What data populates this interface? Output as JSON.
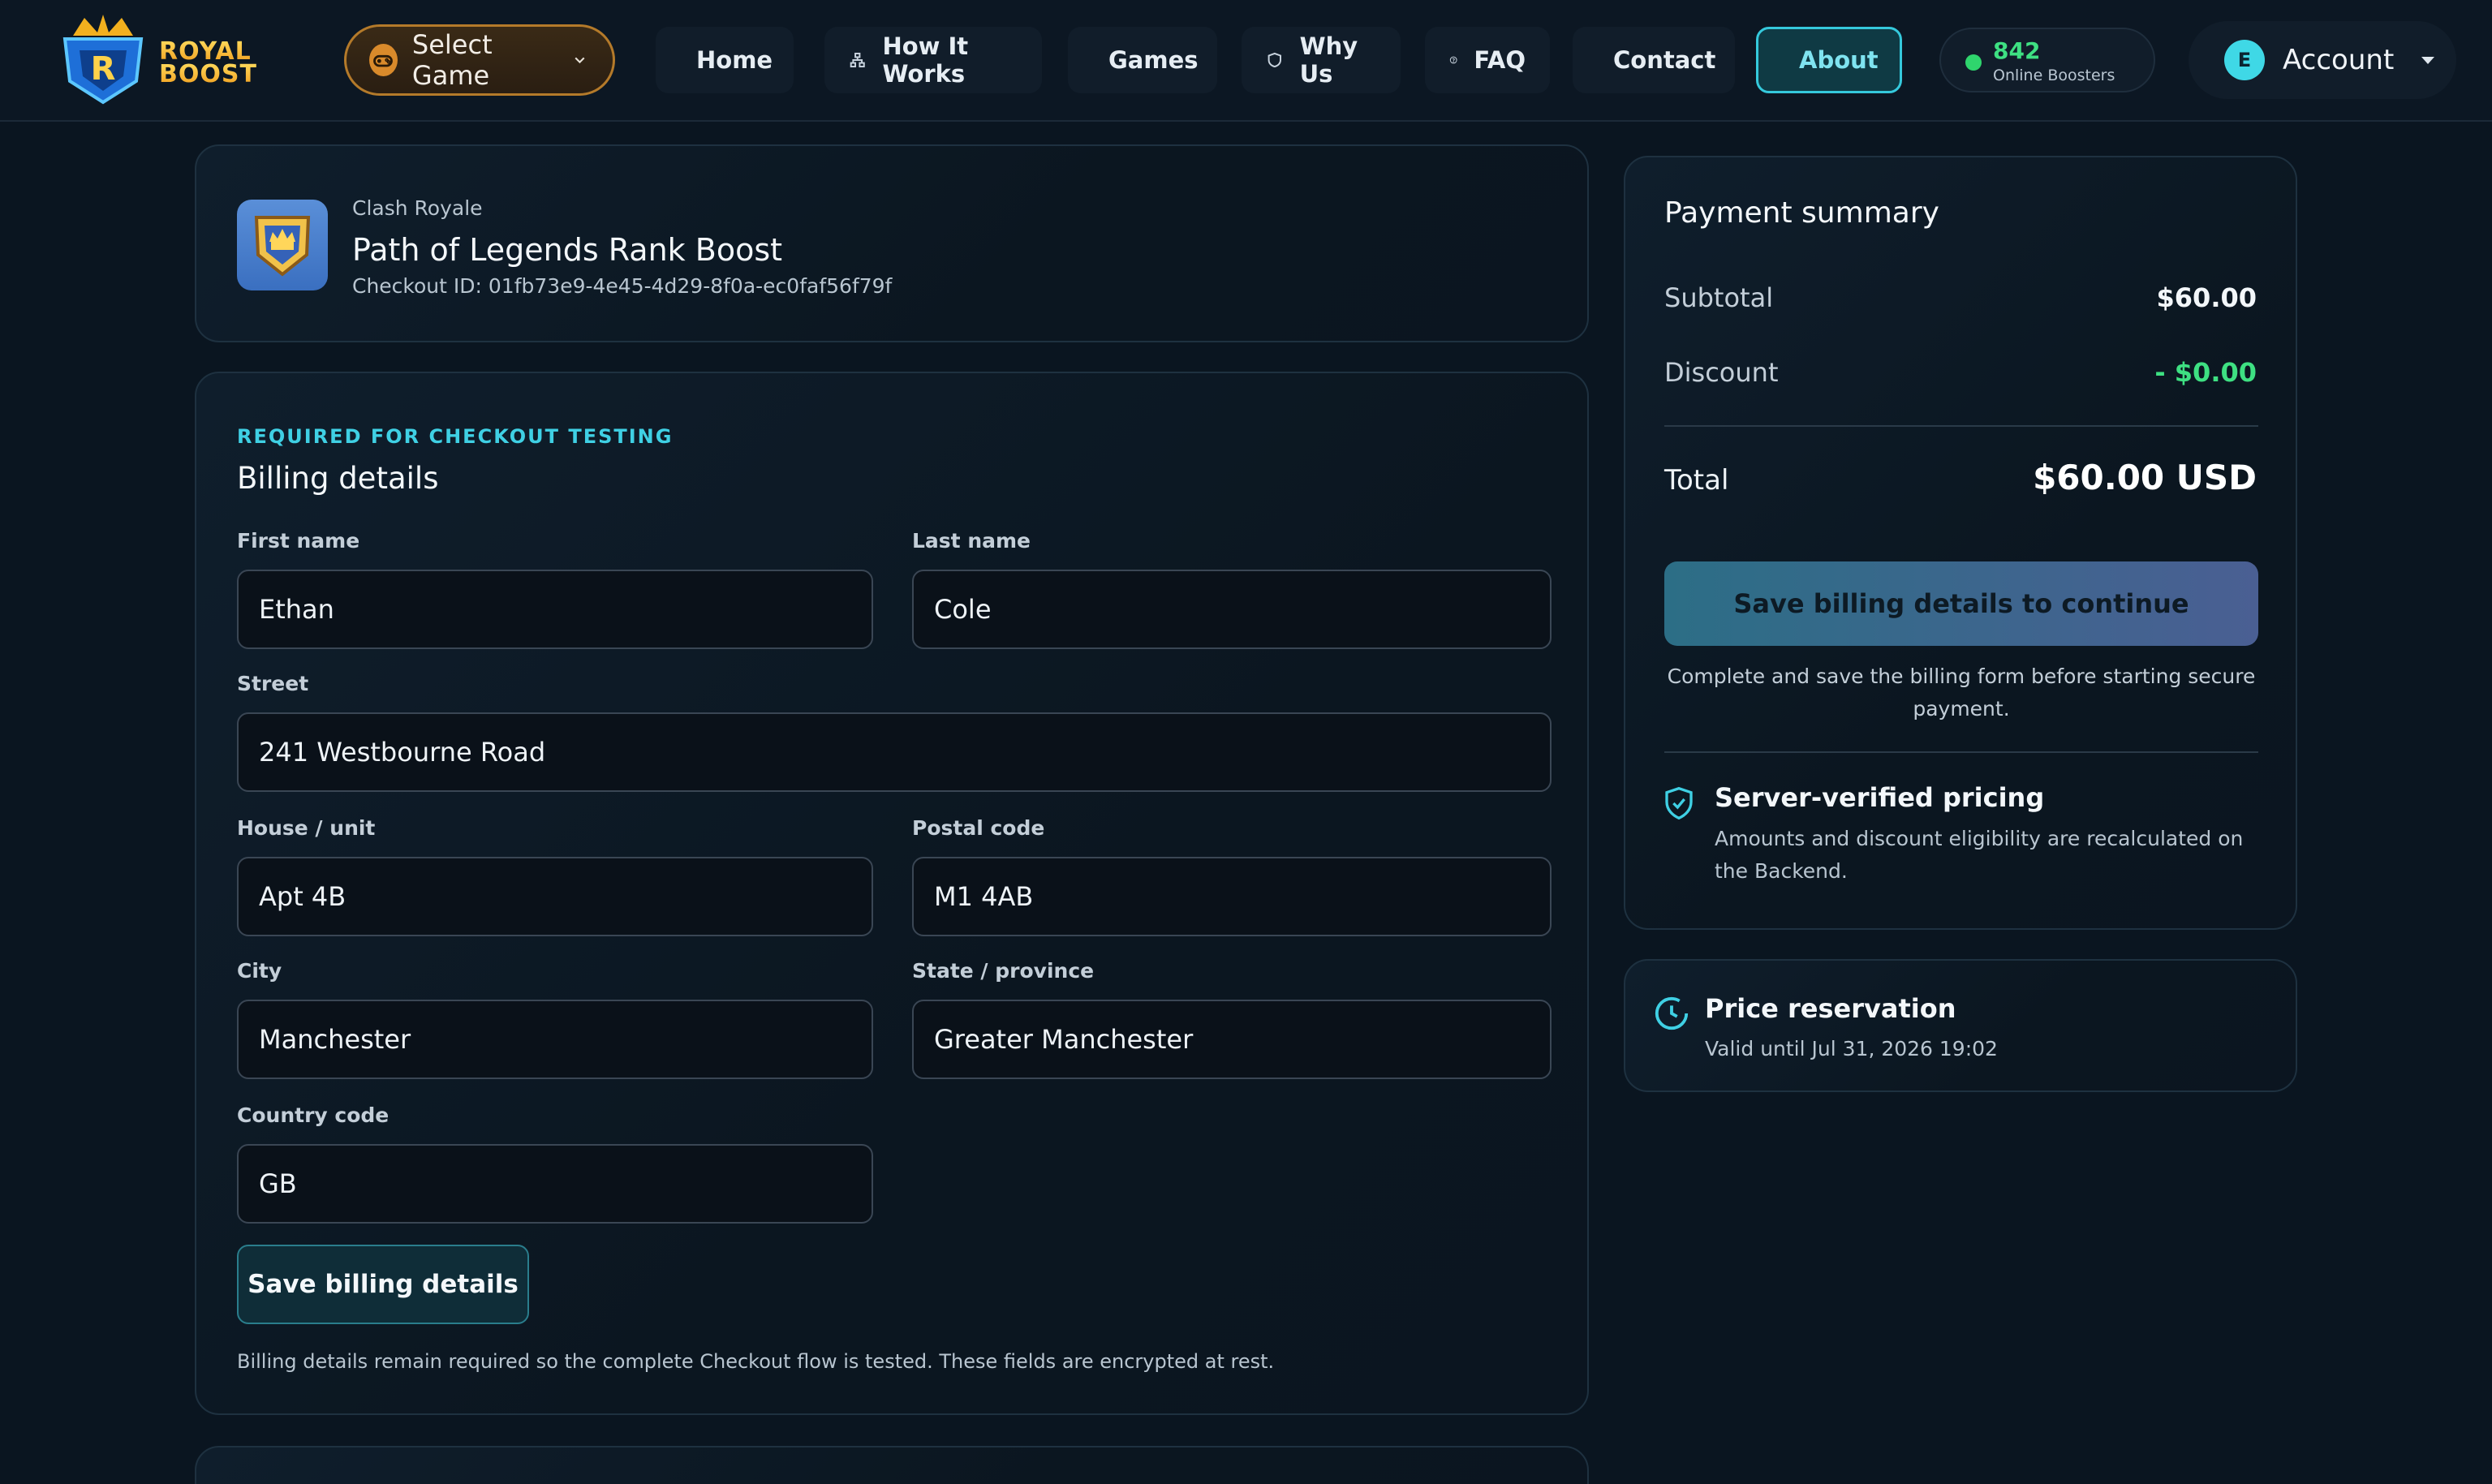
{
  "brand": {
    "line1": "ROYAL",
    "line2": "BOOST"
  },
  "nav": {
    "select_game": "Select Game",
    "items": [
      {
        "label": "Home",
        "icon": "home-icon"
      },
      {
        "label": "How It Works",
        "icon": "workflow-icon"
      },
      {
        "label": "Games",
        "icon": "gamepad-icon"
      },
      {
        "label": "Why Us",
        "icon": "shield-icon"
      },
      {
        "label": "FAQ",
        "icon": "help-circle-icon"
      },
      {
        "label": "Contact",
        "icon": "mail-icon"
      },
      {
        "label": "About",
        "icon": "info-icon",
        "active": true
      }
    ],
    "boosters_count": "842",
    "boosters_label": "Online Boosters",
    "account_initial": "E",
    "account_label": "Account"
  },
  "order": {
    "game": "Clash Royale",
    "title": "Path of Legends Rank Boost",
    "checkout_id": "Checkout ID: 01fb73e9-4e45-4d29-8f0a-ec0faf56f79f"
  },
  "billing": {
    "eyebrow": "REQUIRED FOR CHECKOUT TESTING",
    "title": "Billing details",
    "fields": {
      "first_name": {
        "label": "First name",
        "value": "Ethan"
      },
      "last_name": {
        "label": "Last name",
        "value": "Cole"
      },
      "street": {
        "label": "Street",
        "value": "241 Westbourne Road"
      },
      "house": {
        "label": "House / unit",
        "value": "Apt 4B"
      },
      "postal": {
        "label": "Postal code",
        "value": "M1 4AB"
      },
      "city": {
        "label": "City",
        "value": "Manchester"
      },
      "state": {
        "label": "State / province",
        "value": "Greater Manchester"
      },
      "country": {
        "label": "Country code",
        "value": "GB"
      }
    },
    "save_label": "Save billing details",
    "note": "Billing details remain required so the complete Checkout flow is tested. These fields are encrypted at rest."
  },
  "payment": {
    "title": "Payment summary",
    "subtotal_label": "Subtotal",
    "subtotal_value": "$60.00",
    "discount_label": "Discount",
    "discount_value": "- $0.00",
    "total_label": "Total",
    "total_value": "$60.00 USD",
    "continue_label": "Save billing details to continue",
    "continue_note": "Complete and save the billing form before starting secure payment.",
    "verified_title": "Server-verified pricing",
    "verified_desc": "Amounts and discount eligibility are recalculated on the Backend."
  },
  "reservation": {
    "title": "Price reservation",
    "valid_until": "Valid until Jul 31, 2026 19:02"
  },
  "colors": {
    "accent": "#3fd0e4",
    "discount": "#3ee082",
    "online": "#2fd56d",
    "select_game_border": "#b47a2a"
  }
}
